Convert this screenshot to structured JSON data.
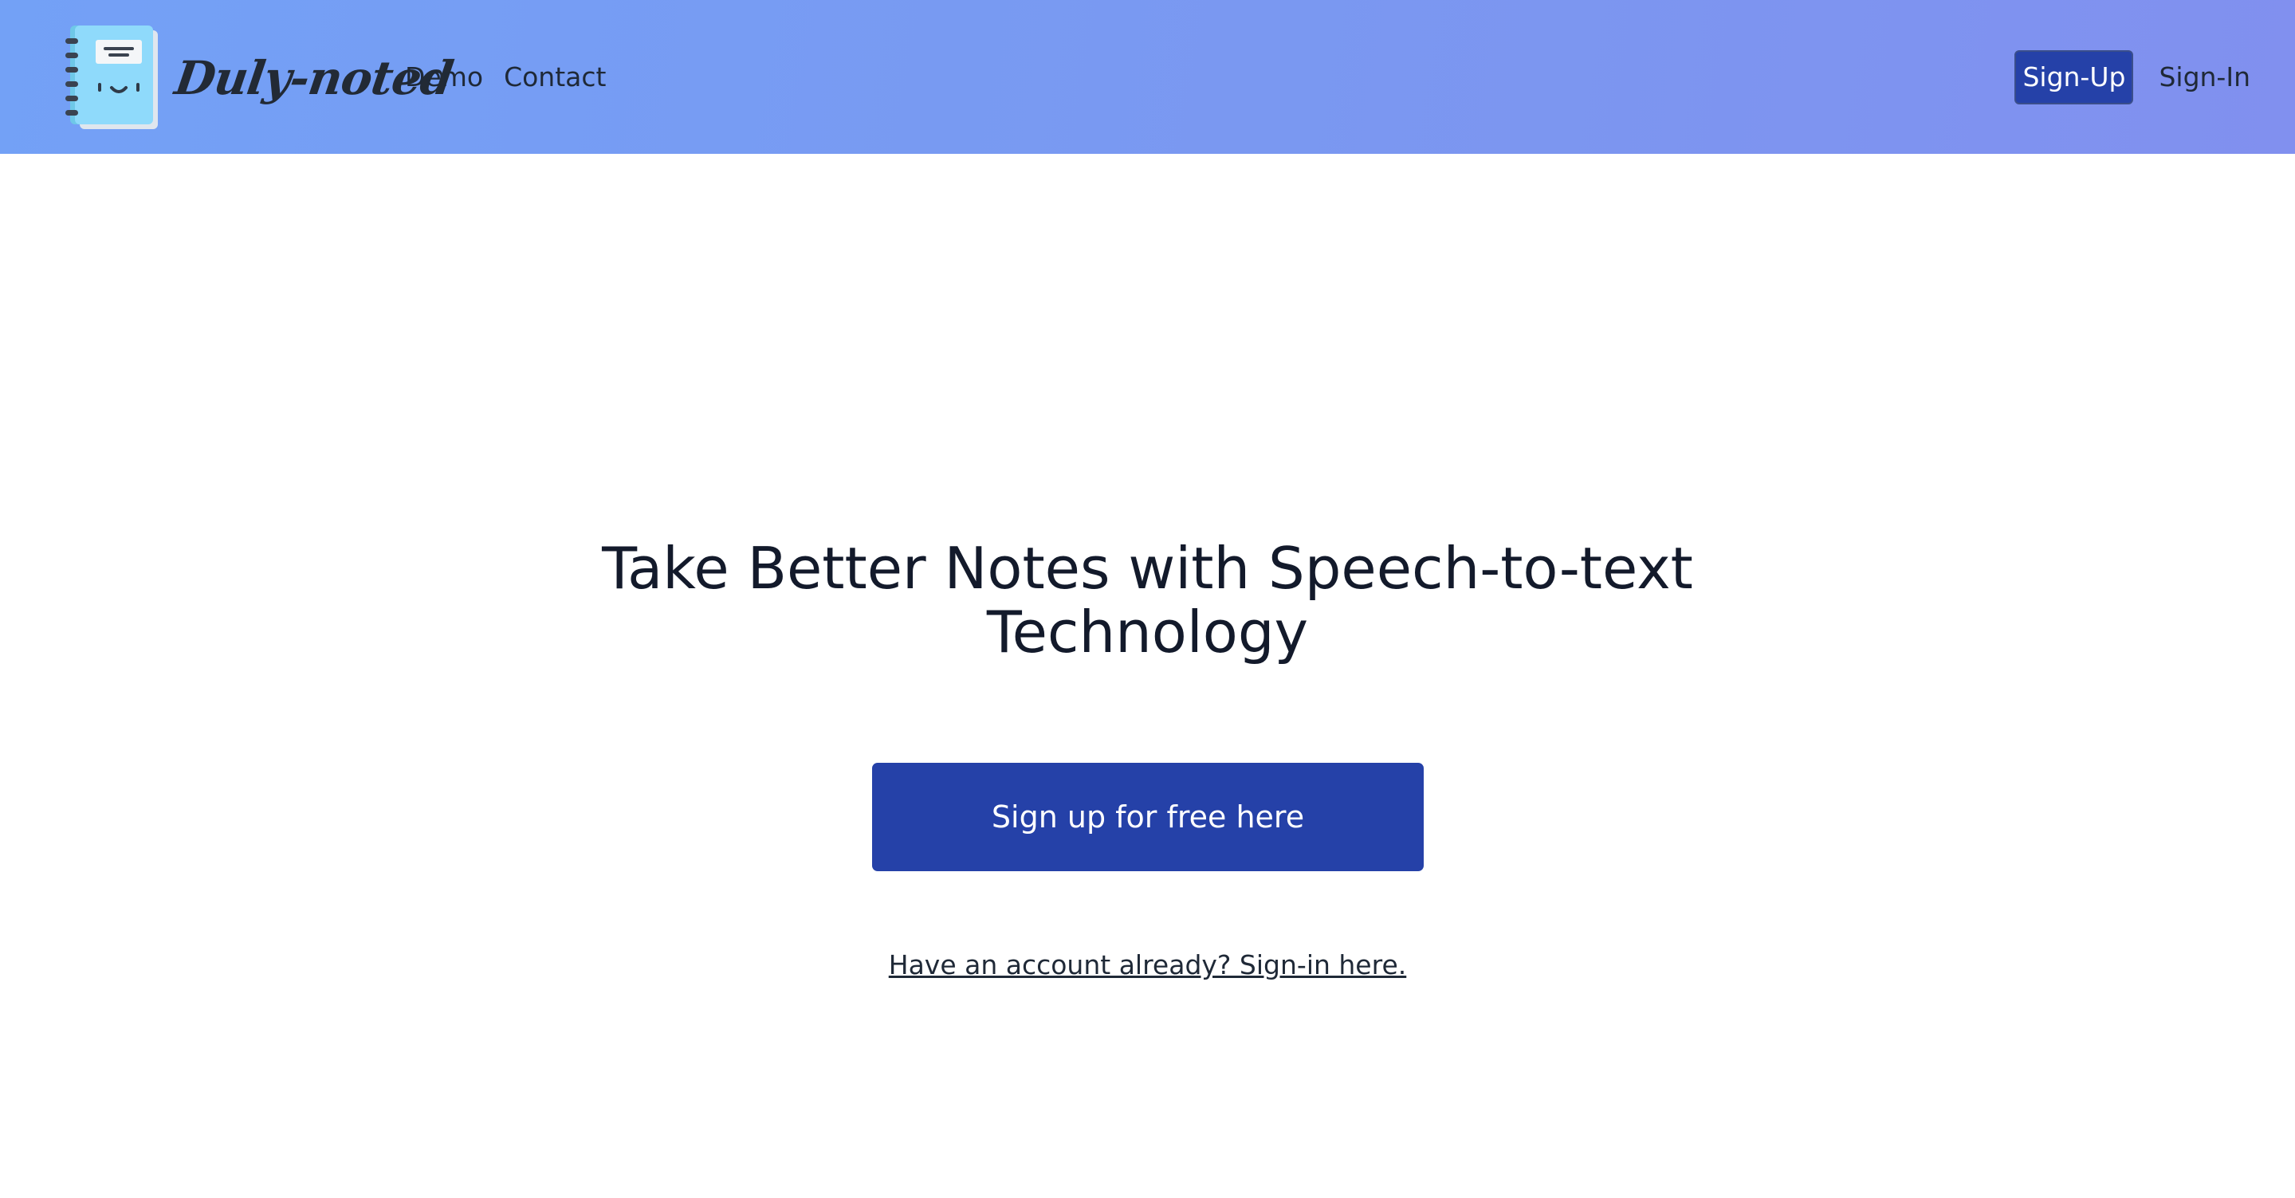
{
  "header": {
    "brand_name": "Duly-noted",
    "nav_links": [
      {
        "label": "Demo"
      },
      {
        "label": "Contact"
      }
    ],
    "signup_label": "Sign-Up",
    "signin_label": "Sign-In"
  },
  "hero": {
    "title_line1": "Take Better Notes with Speech-to-text",
    "title_line2": "Technology",
    "cta_label": "Sign up for free here",
    "signin_link": "Have an account already? Sign-in here."
  },
  "colors": {
    "header_gradient_start": "#73a1f6",
    "header_gradient_end": "#8190ef",
    "primary_button": "#2541a8",
    "logo_cover": "#8fdafb",
    "logo_page": "#eef2f6",
    "text_dark": "#131a2b"
  },
  "icons": {
    "logo": "notebook-icon"
  }
}
